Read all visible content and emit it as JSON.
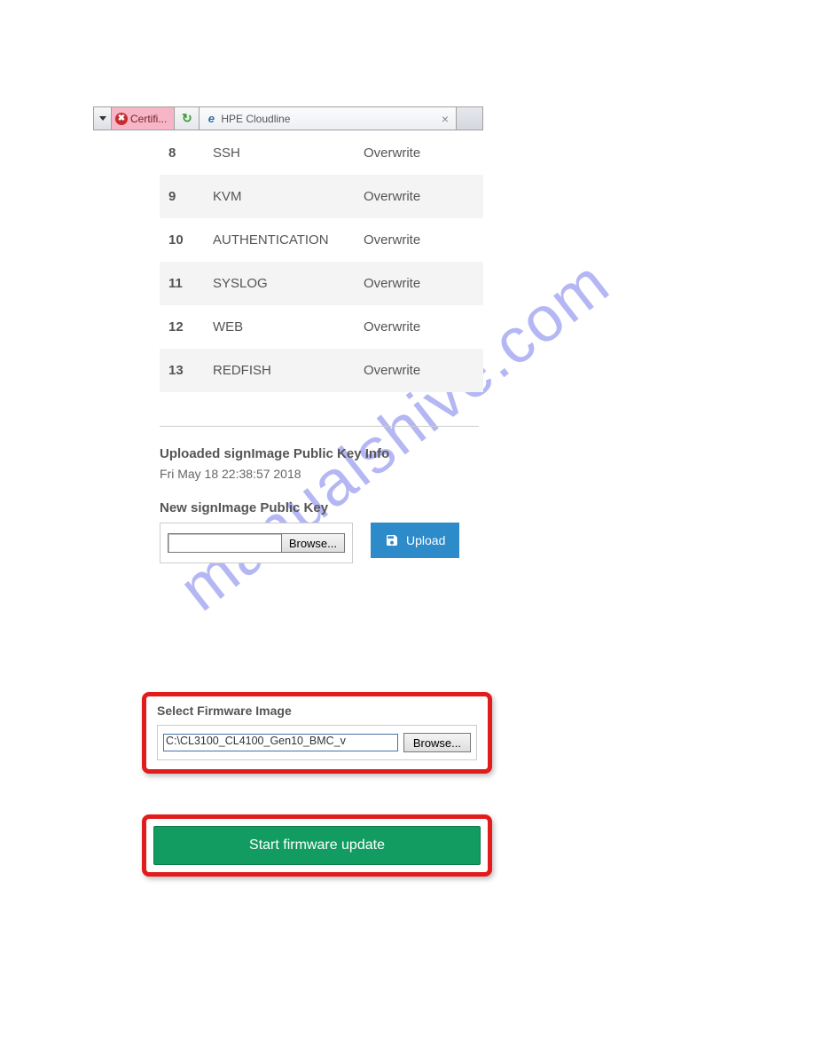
{
  "tabbar": {
    "cert_tab_label": "Certifi...",
    "active_tab_label": "HPE Cloudline",
    "close_glyph": "×"
  },
  "config_table": {
    "rows": [
      {
        "num": "8",
        "name": "SSH",
        "action": "Overwrite"
      },
      {
        "num": "9",
        "name": "KVM",
        "action": "Overwrite"
      },
      {
        "num": "10",
        "name": "AUTHENTICATION",
        "action": "Overwrite"
      },
      {
        "num": "11",
        "name": "SYSLOG",
        "action": "Overwrite"
      },
      {
        "num": "12",
        "name": "WEB",
        "action": "Overwrite"
      },
      {
        "num": "13",
        "name": "REDFISH",
        "action": "Overwrite"
      }
    ]
  },
  "pubkey_info": {
    "title": "Uploaded signImage Public Key Info",
    "timestamp": "Fri May 18 22:38:57 2018",
    "new_label": "New signImage Public Key",
    "browse_label": "Browse...",
    "upload_label": "Upload"
  },
  "firmware": {
    "title": "Select Firmware Image",
    "path": "C:\\CL3100_CL4100_Gen10_BMC_v",
    "browse_label": "Browse..."
  },
  "start": {
    "label": "Start firmware update"
  },
  "watermark": "manualshive.com"
}
